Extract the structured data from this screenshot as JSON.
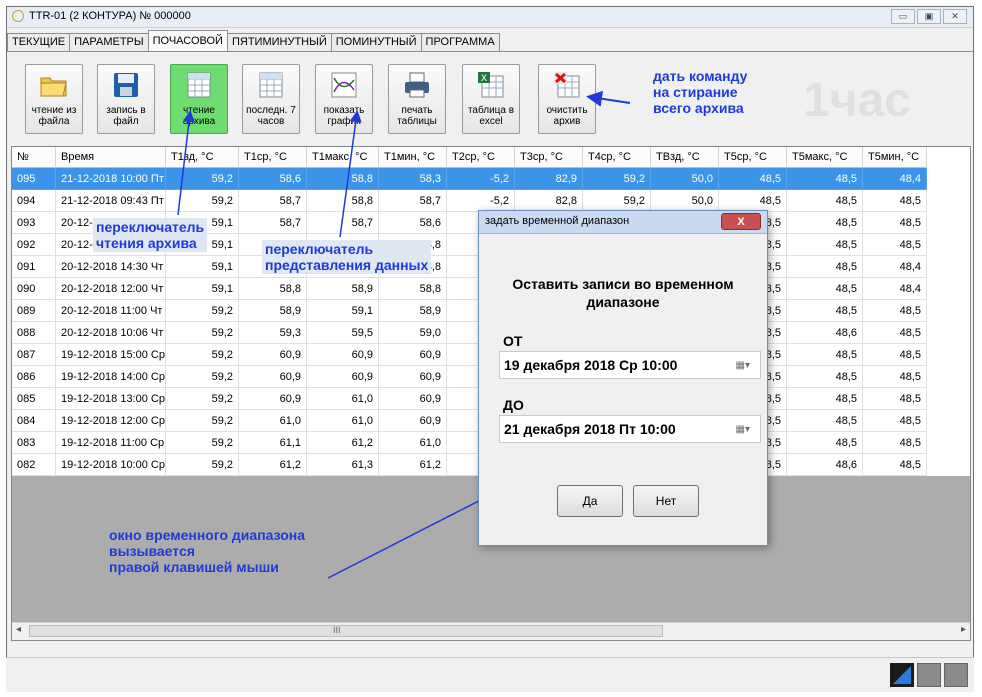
{
  "window": {
    "title": "TTR-01 (2 КОНТУРА) № 000000",
    "controls": [
      "▭",
      "▣",
      "✕"
    ]
  },
  "tabs": [
    "ТЕКУЩИЕ",
    "ПАРАМЕТРЫ",
    "ПОЧАСОВОЙ",
    "ПЯТИМИНУТНЫЙ",
    "ПОМИНУТНЫЙ",
    "ПРОГРАММА"
  ],
  "active_tab": "ПОЧАСОВОЙ",
  "toolbar": {
    "read_file": "чтение из файла",
    "write_file": "запись в файл",
    "read_archive": "чтение архива",
    "last7": "последн. 7 часов",
    "show_graph": "показать график",
    "print_table": "печать таблицы",
    "excel": "таблица в excel",
    "clear_archive": "очистить архив"
  },
  "watermark": "1час",
  "annotations": {
    "erase": [
      "дать команду",
      "на стирание",
      "всего архива"
    ],
    "read_switch": [
      "переключатель",
      "чтения архива"
    ],
    "view_switch": [
      "переключатель",
      "представления данных"
    ],
    "range_window": [
      "окно временного диапазона",
      "вызывается",
      "правой клавишей мыши"
    ]
  },
  "table": {
    "headers": [
      "№",
      "Время",
      "T1зд, °C",
      "T1ср, °C",
      "T1макс, °C",
      "T1мин, °C",
      "T2ср, °C",
      "T3ср, °C",
      "T4ср, °C",
      "TBзд, °C",
      "T5ср, °C",
      "T5макс, °C",
      "T5мин, °C"
    ],
    "rows": [
      [
        "095",
        "21-12-2018 10:00 Пт",
        "59,2",
        "58,6",
        "58,8",
        "58,3",
        "-5,2",
        "82,9",
        "59,2",
        "50,0",
        "48,5",
        "48,5",
        "48,4"
      ],
      [
        "094",
        "21-12-2018 09:43 Пт",
        "59,2",
        "58,7",
        "58,8",
        "58,7",
        "-5,2",
        "82,8",
        "59,2",
        "50,0",
        "48,5",
        "48,5",
        "48,5"
      ],
      [
        "093",
        "20-12-2018 17:00 Чт",
        "59,1",
        "58,7",
        "58,7",
        "58,6",
        "",
        "",
        "",
        "",
        "48,5",
        "48,5",
        "48,5"
      ],
      [
        "092",
        "20-12-2018 15:00 Чт",
        "59,1",
        "58,8",
        "58,9",
        "58,8",
        "",
        "",
        "",
        "",
        "48,5",
        "48,5",
        "48,5"
      ],
      [
        "091",
        "20-12-2018 14:30 Чт",
        "59,1",
        "58,8",
        "58,9",
        "58,8",
        "",
        "",
        "",
        "",
        "48,5",
        "48,5",
        "48,4"
      ],
      [
        "090",
        "20-12-2018 12:00 Чт",
        "59,1",
        "58,8",
        "58,9",
        "58,8",
        "",
        "",
        "",
        "",
        "48,5",
        "48,5",
        "48,4"
      ],
      [
        "089",
        "20-12-2018 11:00 Чт",
        "59,2",
        "58,9",
        "59,1",
        "58,9",
        "",
        "",
        "",
        "",
        "48,5",
        "48,5",
        "48,5"
      ],
      [
        "088",
        "20-12-2018 10:06 Чт",
        "59,2",
        "59,3",
        "59,5",
        "59,0",
        "",
        "",
        "",
        "",
        "48,5",
        "48,6",
        "48,5"
      ],
      [
        "087",
        "19-12-2018 15:00 Ср",
        "59,2",
        "60,9",
        "60,9",
        "60,9",
        "",
        "",
        "",
        "",
        "48,5",
        "48,5",
        "48,5"
      ],
      [
        "086",
        "19-12-2018 14:00 Ср",
        "59,2",
        "60,9",
        "60,9",
        "60,9",
        "",
        "",
        "",
        "",
        "48,5",
        "48,5",
        "48,5"
      ],
      [
        "085",
        "19-12-2018 13:00 Ср",
        "59,2",
        "60,9",
        "61,0",
        "60,9",
        "",
        "",
        "",
        "",
        "48,5",
        "48,5",
        "48,5"
      ],
      [
        "084",
        "19-12-2018 12:00 Ср",
        "59,2",
        "61,0",
        "61,0",
        "60,9",
        "",
        "",
        "",
        "",
        "48,5",
        "48,5",
        "48,5"
      ],
      [
        "083",
        "19-12-2018 11:00 Ср",
        "59,2",
        "61,1",
        "61,2",
        "61,0",
        "",
        "",
        "",
        "",
        "48,5",
        "48,5",
        "48,5"
      ],
      [
        "082",
        "19-12-2018 10:00 Ср",
        "59,2",
        "61,2",
        "61,3",
        "61,2",
        "",
        "",
        "",
        "",
        "48,5",
        "48,6",
        "48,5"
      ]
    ]
  },
  "dialog": {
    "title": "задать временной диапазон",
    "close": "X",
    "prompt": "Оставить записи во временном диапазоне",
    "from_label": "ОТ",
    "from_value": "19 декабря 2018  Ср 10:00",
    "to_label": "ДО",
    "to_value": "21 декабря 2018  Пт 10:00",
    "yes": "Да",
    "no": "Нет"
  },
  "scroll": {
    "thumb_grip": "III"
  },
  "colors": {
    "selected_row": "#3b94e8",
    "annotation": "#1f3ad8",
    "active_button": "#6fdc72"
  }
}
